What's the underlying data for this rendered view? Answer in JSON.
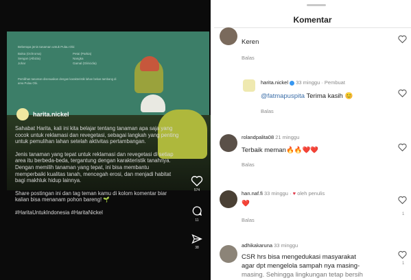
{
  "post": {
    "image": {
      "header": "Beberapa jenis tanaman untuk Pulau Obi:",
      "bullets": [
        "Balsa (Ochroma)",
        "Petai (Parkia)",
        "Sengon (Albizia)",
        "Nangka",
        "Johar",
        "Gamal (Gliricidia)"
      ],
      "footer": "Pemilihan tanaman disesuaikan dengan karakteristik lahan bekas tambang di area Pulau Obi."
    },
    "username": "harita.nickel",
    "caption": [
      "Sahabat Harita, kali ini kita belajar tentang tanaman apa saja yang cocok untuk reklamasi dan revegetasi, sebagai langkah yang penting untuk pemulihan lahan setelah aktivitas pertambangan.",
      "Jenis tanaman yang tepat untuk reklamasi dan revegetasi di setiap area itu berbeda-beda, tergantung dengan karakteristik tanahnya. Dengan memilih tanaman yang tepat, ini bisa membantu memperbaiki kualitas tanah, mencegah erosi, dan menjadi habitat bagi makhluk hidup lainnya.",
      "Share postingan ini dan tag teman kamu di kolom komentar biar kalian bisa menanam pohon bareng! 🌱",
      "#HaritaUntukIndonesia #HaritaNickel"
    ],
    "actions": {
      "likes": "574",
      "comments": "11",
      "shares": "38"
    }
  },
  "comments_panel": {
    "title": "Komentar",
    "reply_label": "Balas",
    "comments": [
      {
        "user": "",
        "time": "",
        "text": "Keren",
        "likes": ""
      },
      {
        "user": "harita.nickel",
        "time": "33 minggu",
        "tag": "Pembuat",
        "mention": "@fatmapuspita",
        "text": "Terima kasih 😊",
        "likes": ""
      },
      {
        "user": "rolandpalita08",
        "time": "21 minggu",
        "text": "Terbaik meman🔥🔥❤️❤️",
        "likes": ""
      },
      {
        "user": "han.naf.fi",
        "time": "33 minggu",
        "tag": "oleh penulis",
        "text": "❤️",
        "likes": "1"
      },
      {
        "user": "adhikakaruna",
        "time": "33 minggu",
        "text": "CSR hrs bisa mengedukasi masyarakat",
        "text2": "agar dpt mengelola sampah nya masing-",
        "text3": "masing. Sehingga lingkungan tetap bersih",
        "likes": "1"
      }
    ]
  },
  "colors": {
    "post_bg": "#0b0b0b",
    "image_green": "#3c7e68",
    "mention_blue": "#3b6ea8"
  }
}
